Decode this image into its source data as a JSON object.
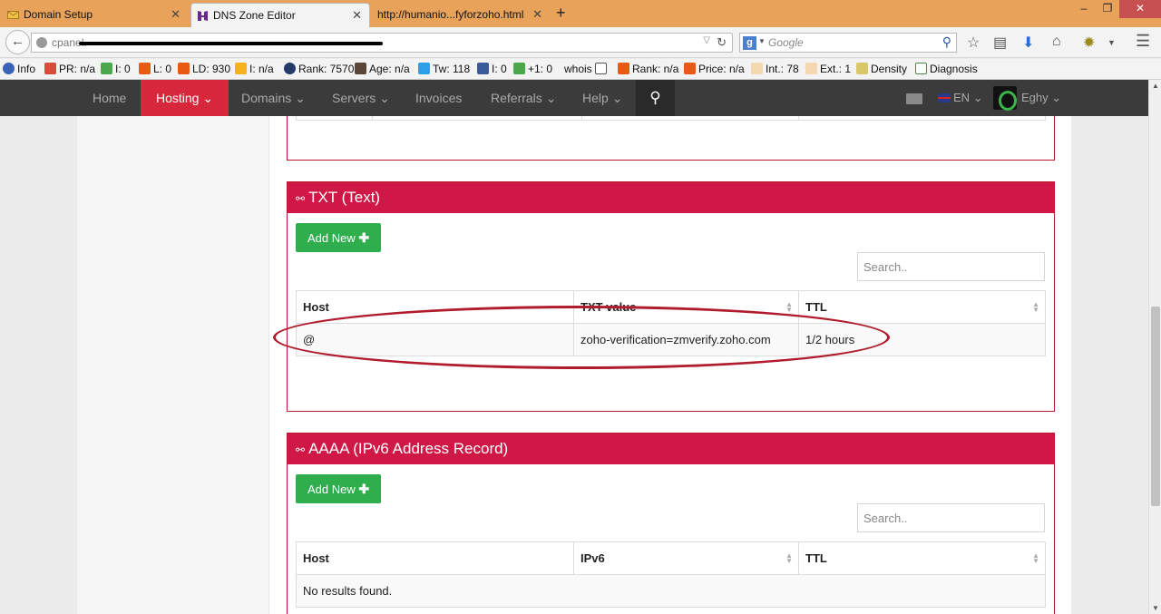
{
  "browser": {
    "tabs": [
      {
        "title": "Domain Setup",
        "active": false
      },
      {
        "title": "DNS Zone Editor",
        "active": true
      },
      {
        "title": "http://humanio...fyforzoho.html",
        "active": false
      }
    ],
    "url_visible": "cpanel.",
    "search_placeholder": "Google",
    "addons": [
      {
        "label": "Info"
      },
      {
        "label": "PR: n/a"
      },
      {
        "label": "I: 0"
      },
      {
        "label": "L: 0"
      },
      {
        "label": "LD: 930"
      },
      {
        "label": "I: n/a"
      },
      {
        "label": "Rank: 7570"
      },
      {
        "label": "Age: n/a"
      },
      {
        "label": "Tw: 118"
      },
      {
        "label": "I: 0"
      },
      {
        "label": "+1: 0"
      },
      {
        "label": "whois"
      },
      {
        "label": "Rank: n/a"
      },
      {
        "label": "Price: n/a"
      },
      {
        "label": "Int.: 78"
      },
      {
        "label": "Ext.: 1"
      },
      {
        "label": "Density"
      },
      {
        "label": "Diagnosis"
      }
    ]
  },
  "site_nav": {
    "items": [
      {
        "label": "Home",
        "caret": false
      },
      {
        "label": "Hosting",
        "caret": true,
        "active": true
      },
      {
        "label": "Domains",
        "caret": true
      },
      {
        "label": "Servers",
        "caret": true
      },
      {
        "label": "Invoices",
        "caret": false
      },
      {
        "label": "Referrals",
        "caret": true
      },
      {
        "label": "Help",
        "caret": true
      }
    ],
    "language": "EN",
    "username": "Eghy"
  },
  "txt_panel": {
    "title": "TXT (Text)",
    "add_button": "Add New",
    "search_placeholder": "Search..",
    "columns": [
      "Host",
      "TXT value",
      "TTL"
    ],
    "rows": [
      {
        "host": "@",
        "value": "zoho-verification=zmverify.zoho.com",
        "ttl": "1/2 hours"
      }
    ]
  },
  "aaaa_panel": {
    "title": "AAAA (IPv6 Address Record)",
    "add_button": "Add New",
    "search_placeholder": "Search..",
    "columns": [
      "Host",
      "IPv6",
      "TTL"
    ],
    "empty_text": "No results found."
  },
  "colors": {
    "panel_header": "#d01846",
    "nav_active": "#d7283b",
    "add_button": "#2fae4e",
    "highlight": "#b01c2e"
  }
}
